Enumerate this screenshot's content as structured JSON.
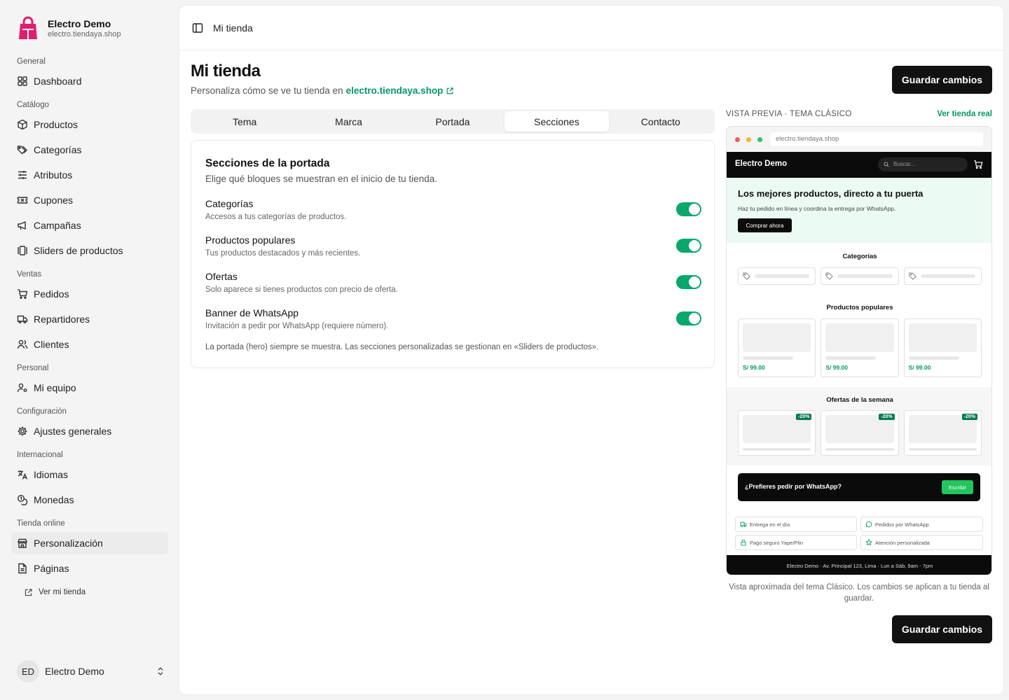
{
  "brand": {
    "name": "Electro Demo",
    "url": "electro.tiendaya.shop",
    "logo_color": "#e11d6c"
  },
  "nav": {
    "groups": [
      {
        "title": "General",
        "items": [
          {
            "label": "Dashboard",
            "icon": "dashboard-icon"
          }
        ]
      },
      {
        "title": "Catálogo",
        "items": [
          {
            "label": "Productos",
            "icon": "box-icon"
          },
          {
            "label": "Categorías",
            "icon": "tags-icon"
          },
          {
            "label": "Atributos",
            "icon": "sliders-icon"
          },
          {
            "label": "Cupones",
            "icon": "ticket-icon"
          },
          {
            "label": "Campañas",
            "icon": "megaphone-icon"
          },
          {
            "label": "Sliders de productos",
            "icon": "gallery-icon"
          }
        ]
      },
      {
        "title": "Ventas",
        "items": [
          {
            "label": "Pedidos",
            "icon": "cart-icon"
          },
          {
            "label": "Repartidores",
            "icon": "truck-icon"
          },
          {
            "label": "Clientes",
            "icon": "users-icon"
          }
        ]
      },
      {
        "title": "Personal",
        "items": [
          {
            "label": "Mi equipo",
            "icon": "user-cog-icon"
          }
        ]
      },
      {
        "title": "Configuración",
        "items": [
          {
            "label": "Ajustes generales",
            "icon": "gear-icon"
          }
        ]
      },
      {
        "title": "Internacional",
        "items": [
          {
            "label": "Idiomas",
            "icon": "translate-icon"
          },
          {
            "label": "Monedas",
            "icon": "coins-icon"
          }
        ]
      },
      {
        "title": "Tienda online",
        "items": [
          {
            "label": "Personalización",
            "icon": "store-icon",
            "active": true
          },
          {
            "label": "Páginas",
            "icon": "file-icon"
          }
        ]
      }
    ],
    "view_store": "Ver mi tienda"
  },
  "user": {
    "initials": "ED",
    "name": "Electro Demo"
  },
  "topbar": {
    "crumb": "Mi tienda"
  },
  "page": {
    "title": "Mi tienda",
    "subtitle": "Personaliza cómo se ve tu tienda en",
    "subtitle_link": "electro.tiendaya.shop",
    "save_label": "Guardar cambios"
  },
  "tabs": [
    {
      "label": "Tema",
      "active": false
    },
    {
      "label": "Marca",
      "active": false
    },
    {
      "label": "Portada",
      "active": false
    },
    {
      "label": "Secciones",
      "active": true
    },
    {
      "label": "Contacto",
      "active": false
    }
  ],
  "sections_card": {
    "title": "Secciones de la portada",
    "subtitle": "Elige qué bloques se muestran en el inicio de tu tienda.",
    "rows": [
      {
        "name": "Categorías",
        "desc": "Accesos a tus categorías de productos.",
        "enabled": true
      },
      {
        "name": "Productos populares",
        "desc": "Tus productos destacados y más recientes.",
        "enabled": true
      },
      {
        "name": "Ofertas",
        "desc": "Solo aparece si tienes productos con precio de oferta.",
        "enabled": true
      },
      {
        "name": "Banner de WhatsApp",
        "desc": "Invitación a pedir por WhatsApp (requiere número).",
        "enabled": true
      }
    ],
    "note": "La portada (hero) siempre se muestra. Las secciones personalizadas se gestionan en «Sliders de productos»."
  },
  "preview": {
    "label": "VISTA PREVIA · TEMA CLÁSICO",
    "link": "Ver tienda real",
    "url": "electro.tiendaya.shop",
    "store_name": "Electro Demo",
    "search_placeholder": "Buscar...",
    "hero_title": "Los mejores productos, directo a tu puerta",
    "hero_text": "Haz tu pedido en línea y coordina la entrega por WhatsApp.",
    "hero_cta": "Comprar ahora",
    "categories_title": "Categorías",
    "popular_title": "Productos populares",
    "prices": [
      "S/ 99.00",
      "S/ 99.00",
      "S/ 99.00"
    ],
    "offers_title": "Ofertas de la semana",
    "discounts": [
      "-20%",
      "-20%",
      "-20%"
    ],
    "wa_text": "¿Prefieres pedir por WhatsApp?",
    "wa_button": "Escribir",
    "features": [
      {
        "label": "Entrega en el día",
        "icon": "truck-icon"
      },
      {
        "label": "Pedidos por WhatsApp",
        "icon": "chat-icon"
      },
      {
        "label": "Pago seguro Yape/Plin",
        "icon": "lock-icon"
      },
      {
        "label": "Atención personalizada",
        "icon": "star-icon"
      }
    ],
    "footer": "Electro Demo · Av. Principal 123, Lima · Lun a Sáb, 9am - 7pm",
    "caption": "Vista aproximada del tema Clásico. Los cambios se aplican a tu tienda al guardar.",
    "accent": "#059669"
  }
}
